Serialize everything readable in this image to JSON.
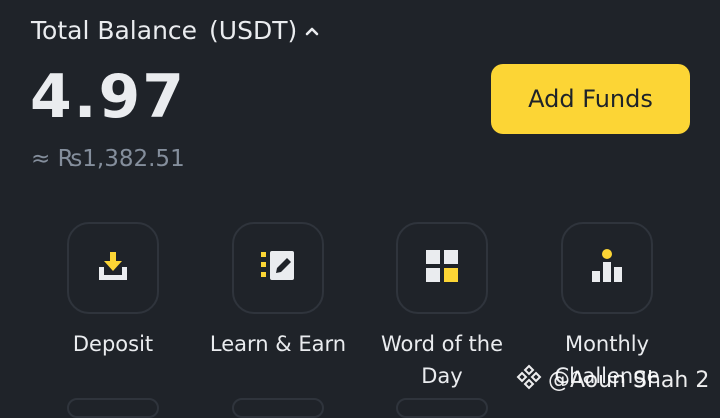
{
  "balance": {
    "label": "Total Balance",
    "currency": "(USDT)",
    "amount": "4.97",
    "fiat": "≈ ₨1,382.51",
    "toggle_icon": "chevron-up-icon"
  },
  "add_funds_label": "Add Funds",
  "actions": [
    {
      "label": "Deposit",
      "icon": "deposit-icon"
    },
    {
      "label": "Learn & Earn",
      "icon": "learn-earn-icon"
    },
    {
      "label": "Word of the Day",
      "icon": "word-of-day-icon"
    },
    {
      "label": "Monthly Challenge",
      "icon": "monthly-challenge-icon"
    }
  ],
  "watermark": {
    "text": "@Aoun Shah 2",
    "icon": "binance-logo-icon"
  },
  "colors": {
    "accent": "#fcd535",
    "background": "#1f2329",
    "muted": "#848e9c"
  }
}
